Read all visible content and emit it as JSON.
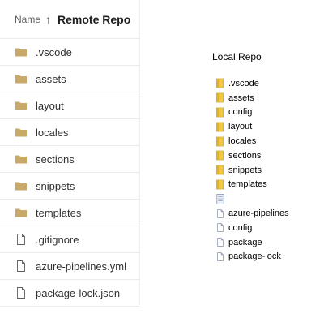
{
  "remote": {
    "header": {
      "name_label": "Name",
      "sort_arrow": "↑",
      "title": "Remote Repo"
    },
    "items": [
      {
        "label": ".vscode",
        "icon": "folder-icon"
      },
      {
        "label": "assets",
        "icon": "folder-icon"
      },
      {
        "label": "layout",
        "icon": "folder-icon"
      },
      {
        "label": "locales",
        "icon": "folder-icon"
      },
      {
        "label": "sections",
        "icon": "folder-icon"
      },
      {
        "label": "snippets",
        "icon": "folder-icon"
      },
      {
        "label": "templates",
        "icon": "folder-icon"
      },
      {
        "label": ".gitignore",
        "icon": "file-icon"
      },
      {
        "label": "azure-pipelines.yml",
        "icon": "file-icon"
      },
      {
        "label": "package-lock.json",
        "icon": "file-icon"
      }
    ]
  },
  "local": {
    "title": "Local Repo",
    "items": [
      {
        "label": ".vscode",
        "icon": "folder-icon"
      },
      {
        "label": "assets",
        "icon": "folder-icon"
      },
      {
        "label": "config",
        "icon": "folder-icon"
      },
      {
        "label": "layout",
        "icon": "folder-icon"
      },
      {
        "label": "locales",
        "icon": "folder-icon"
      },
      {
        "label": "sections",
        "icon": "folder-icon"
      },
      {
        "label": "snippets",
        "icon": "folder-icon"
      },
      {
        "label": "templates",
        "icon": "folder-icon"
      },
      {
        "label": "",
        "icon": "text-file-icon"
      },
      {
        "label": "azure-pipelines",
        "icon": "file-icon"
      },
      {
        "label": "config",
        "icon": "file-icon"
      },
      {
        "label": "package",
        "icon": "file-icon"
      },
      {
        "label": "package-lock",
        "icon": "file-icon"
      }
    ]
  },
  "colors": {
    "folder_remote": "#c8a96a",
    "folder_local": "#f2c744",
    "file_outline": "#605e5c"
  }
}
